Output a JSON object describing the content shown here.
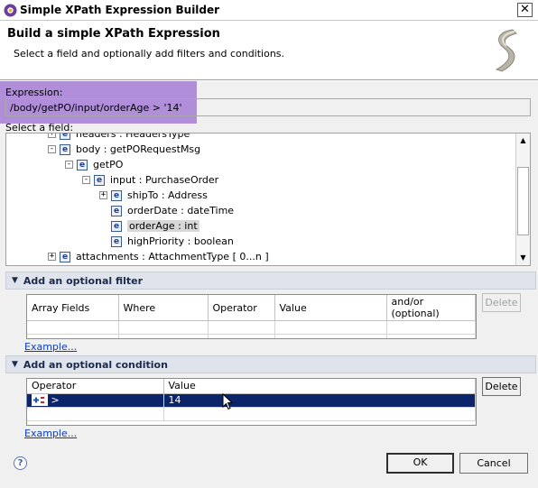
{
  "window": {
    "title": "Simple XPath Expression Builder"
  },
  "banner": {
    "heading": "Build a simple XPath Expression",
    "subtitle": "Select a field and optionally add filters and conditions."
  },
  "expression": {
    "label": "Expression:",
    "value": "/body/getPO/input/orderAge > '14'"
  },
  "field_tree": {
    "label": "Select a field:",
    "items": [
      {
        "label": "headers : HeadersType",
        "expander": "+",
        "selected": false
      },
      {
        "label": "body : getPORequestMsg",
        "expander": "-",
        "selected": false
      },
      {
        "label": "getPO",
        "expander": "-",
        "selected": false
      },
      {
        "label": "input : PurchaseOrder",
        "expander": "-",
        "selected": false
      },
      {
        "label": "shipTo : Address",
        "expander": "+",
        "selected": false
      },
      {
        "label": "orderDate : dateTime",
        "expander": "",
        "selected": false
      },
      {
        "label": "orderAge : int",
        "expander": "",
        "selected": true
      },
      {
        "label": "highPriority : boolean",
        "expander": "",
        "selected": false
      },
      {
        "label": "attachments : AttachmentType [ 0...n ]",
        "expander": "+",
        "selected": false
      }
    ]
  },
  "filter_section": {
    "title": "Add an optional filter",
    "columns": [
      "Array Fields",
      "Where",
      "Operator",
      "Value",
      "and/or (optional)"
    ],
    "delete_label": "Delete",
    "example_link": "Example..."
  },
  "condition_section": {
    "title": "Add an optional condition",
    "columns": [
      "Operator",
      "Value"
    ],
    "rows": [
      {
        "operator": ">",
        "value": "14"
      }
    ],
    "delete_label": "Delete",
    "example_link": "Example..."
  },
  "footer": {
    "ok_label": "OK",
    "cancel_label": "Cancel",
    "help_glyph": "?"
  },
  "icons": {
    "element": "e",
    "close": "✕",
    "collapse_triangle": "▼",
    "scroll_up": "▲",
    "scroll_down": "▼"
  },
  "colors": {
    "highlight": "#9b6ed2",
    "selection": "#0b246a",
    "link": "#0b3bc2"
  }
}
